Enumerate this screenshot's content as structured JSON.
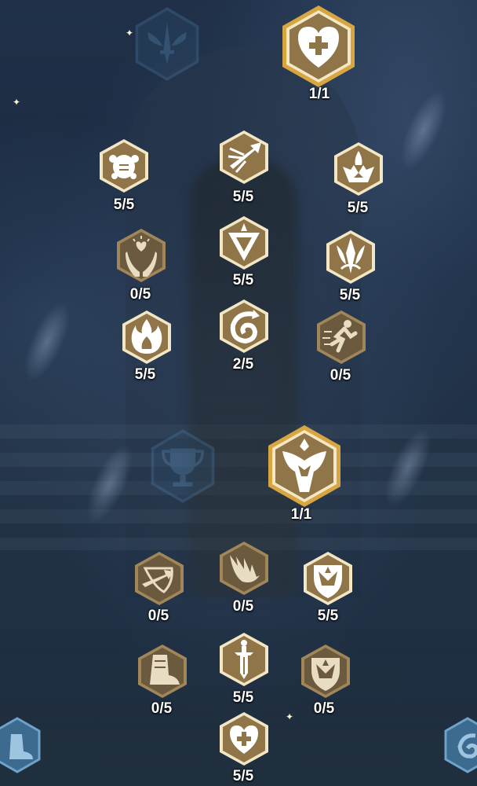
{
  "skill_tree": {
    "branch_1": {
      "keystone": {
        "icon": "heart-plus-icon",
        "value": "1/1"
      },
      "left_col": [
        {
          "icon": "shell-turtle-icon",
          "value": "5/5"
        },
        {
          "icon": "hands-heart-icon",
          "value": "0/5"
        },
        {
          "icon": "flame-icon",
          "value": "5/5"
        }
      ],
      "mid_col": [
        {
          "icon": "arrow-burst-icon",
          "value": "5/5"
        },
        {
          "icon": "triangle-crest-icon",
          "value": "5/5"
        },
        {
          "icon": "swirl-wind-icon",
          "value": "2/5"
        }
      ],
      "right_col": [
        {
          "icon": "crown-flame-icon",
          "value": "5/5"
        },
        {
          "icon": "spiked-emblem-icon",
          "value": "5/5"
        },
        {
          "icon": "running-man-icon",
          "value": "0/5"
        }
      ]
    },
    "branch_2": {
      "keystone": {
        "icon": "horned-helm-icon",
        "value": "1/1"
      },
      "left_col": [
        {
          "icon": "arrow-shield-icon",
          "value": "0/5"
        },
        {
          "icon": "boot-icon",
          "value": "0/5"
        }
      ],
      "mid_col": [
        {
          "icon": "eagle-wing-icon",
          "value": "0/5"
        },
        {
          "icon": "sword-icon",
          "value": "5/5"
        },
        {
          "icon": "heart-plus-small-icon",
          "value": "5/5"
        }
      ],
      "right_col": [
        {
          "icon": "crest-shield-icon",
          "value": "5/5"
        },
        {
          "icon": "crest-shield-dim-icon",
          "value": "0/5"
        }
      ]
    },
    "faded_icons": [
      "winged-sword-icon",
      "trophy-icon"
    ],
    "edge_icons": [
      "left-boot-edge-icon",
      "right-swirl-edge-icon"
    ],
    "colors": {
      "active_fill": "#8f7547",
      "inactive_fill": "#6b5a3e",
      "border_light": "#f3e6c4",
      "keystone_gold": "#c99632",
      "glyph": "#ffffff"
    }
  }
}
